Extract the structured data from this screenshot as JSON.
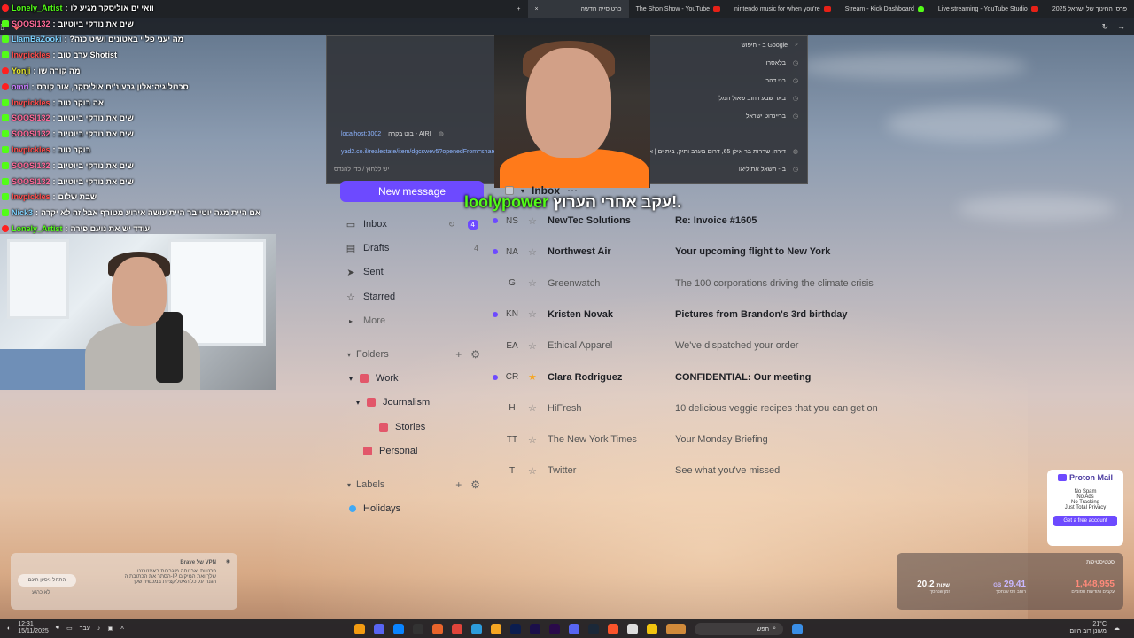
{
  "tabs": [
    {
      "label": "פרסי החינוך של ישראל 2025"
    },
    {
      "label": "Live streaming - YouTube Studio"
    },
    {
      "label": "Stream - Kick Dashboard"
    },
    {
      "label": "nintendo music for when you're"
    },
    {
      "label": "The Shon Show - YouTube"
    },
    {
      "label": "כרטיסייה חדשה"
    }
  ],
  "chat": [
    {
      "user": "Lonely_Artist",
      "text": "וואי ים אוליסקר מגיע לו",
      "ucolor": "#53fc18",
      "src": "yt"
    },
    {
      "user": "SOOSI132",
      "text": "שים את נודקי ביוטיוב",
      "ucolor": "#ff6b9a",
      "src": "kick"
    },
    {
      "user": "LlamBaZooki",
      "text": "?מה יעני פליי באטונים ושיט כזה",
      "ucolor": "#7fd3ff",
      "src": "kick"
    },
    {
      "user": "Invpickles",
      "text": "ערב טוב Shotist",
      "ucolor": "#ff4d4d",
      "src": "kick"
    },
    {
      "user": "Yonji",
      "text": "מה קורה שו",
      "ucolor": "#e6e62a",
      "src": "yt"
    },
    {
      "user": "omri",
      "text": "סכנולוגיה:אלון גרעינ'ים אוליסקר, אור קורס",
      "ucolor": "#c97cff",
      "src": "yt"
    },
    {
      "user": "Invpickles",
      "text": "אה בוקר טוב",
      "ucolor": "#ff4d4d",
      "src": "kick"
    },
    {
      "user": "SOOSI132",
      "text": "שים את נודקי ביוטיוב",
      "ucolor": "#ff6b9a",
      "src": "kick"
    },
    {
      "user": "SOOSI132",
      "text": "שים את נודקי ביוטיוב",
      "ucolor": "#ff6b9a",
      "src": "kick"
    },
    {
      "user": "Invpickles",
      "text": "בוקר טוב",
      "ucolor": "#ff4d4d",
      "src": "kick"
    },
    {
      "user": "SOOSI132",
      "text": "שים את נודקי ביוטיוב",
      "ucolor": "#ff6b9a",
      "src": "kick"
    },
    {
      "user": "SOOSI132",
      "text": "שים את נודקי ביוטיוב",
      "ucolor": "#ff6b9a",
      "src": "kick"
    },
    {
      "user": "Invpickles",
      "text": "שבת שלום",
      "ucolor": "#ff4d4d",
      "src": "kick"
    },
    {
      "user": "Nick3",
      "text": "אם היית מגה יוטיובר היית עושה אירוע מטורף אבל זה לא יקרה",
      "ucolor": "#7fd3ff",
      "src": "kick"
    },
    {
      "user": "Lonely_Artist",
      "text": "עודד יש את נועם פירה",
      "ucolor": "#53fc18",
      "src": "yt"
    }
  ],
  "suggestions": [
    {
      "text": "ב - חיפוש Google"
    },
    {
      "text": "בלאסרו"
    },
    {
      "text": "בני דהר"
    },
    {
      "text": "באר שבע רחוב שאול המלך"
    },
    {
      "text": "בריינרוט ישראל"
    },
    {
      "text": "בוט בקרה - AIRI",
      "url": "localhost:3002"
    },
    {
      "text": "דירה, שדרות בר אילן 65, דרום מערב ותיק, בית ים | אלפי מודעות",
      "url": "yad2.co.il/realestate/item/dgcswev5?openedFrom=share#galleryM"
    },
    {
      "text": "ב - תשאל את ליאו",
      "hint": "יש ללחוץ / כדי להנדס"
    }
  ],
  "overlay": {
    "user": "loolypower",
    "text": "עקב אחרי הערוץ!."
  },
  "mail": {
    "new_message": "New message",
    "nav": {
      "inbox": "Inbox",
      "inbox_count": "4",
      "drafts": "Drafts",
      "drafts_count": "4",
      "sent": "Sent",
      "starred": "Starred",
      "more": "More"
    },
    "folders_label": "Folders",
    "folders": {
      "work": "Work",
      "journalism": "Journalism",
      "stories": "Stories",
      "personal": "Personal"
    },
    "labels_label": "Labels",
    "labels": {
      "holidays": "Holidays"
    },
    "inbox_title": "Inbox",
    "messages": [
      {
        "initials": "NS",
        "sender": "NewTec Solutions",
        "subject": "Re: Invoice #1605",
        "unread": true,
        "starred": false
      },
      {
        "initials": "NA",
        "sender": "Northwest Air",
        "subject": "Your upcoming flight to New York",
        "unread": true,
        "starred": false
      },
      {
        "initials": "G",
        "sender": "Greenwatch",
        "subject": "The 100 corporations driving the climate crisis",
        "unread": false,
        "starred": false
      },
      {
        "initials": "KN",
        "sender": "Kristen Novak",
        "subject": "Pictures from Brandon's 3rd birthday",
        "unread": true,
        "starred": false
      },
      {
        "initials": "EA",
        "sender": "Ethical Apparel",
        "subject": "We've dispatched your order",
        "unread": false,
        "starred": false
      },
      {
        "initials": "CR",
        "sender": "Clara Rodriguez",
        "subject": "CONFIDENTIAL: Our meeting",
        "unread": true,
        "starred": true
      },
      {
        "initials": "H",
        "sender": "HiFresh",
        "subject": "10 delicious veggie recipes that you can get on",
        "unread": false,
        "starred": false
      },
      {
        "initials": "TT",
        "sender": "The New York Times",
        "subject": "Your Monday Briefing",
        "unread": false,
        "starred": false
      },
      {
        "initials": "T",
        "sender": "Twitter",
        "subject": "See what you've missed",
        "unread": false,
        "starred": false
      }
    ]
  },
  "proton_promo": {
    "brand": "Proton Mail",
    "lines": [
      "No Spam",
      "No Ads",
      "No Tracking",
      "Just Total Privacy"
    ],
    "cta": "Get a free account"
  },
  "vpn_promo": {
    "title": "Brave של VPN",
    "lines": [
      "פרטיות ואבטחה מוגברות באינטרנט",
      "הסתר את הכתובת ה-IP שלך ואת המיקום",
      "הגנה על כל האפליקציות במכשיר שלך"
    ],
    "button": "התחל ניסיון חינם",
    "dismiss": "לא כרגע"
  },
  "stats": {
    "title": "סטטיסטיקות",
    "items": [
      {
        "value": "1,448,955",
        "label": "עקבים ומודעות חסומים"
      },
      {
        "value": "29.41",
        "unit": "GB",
        "label": "רוחב פס שנחסך"
      },
      {
        "value": "20.2",
        "unit": "שעות",
        "label": "זמן שנחסך"
      }
    ]
  },
  "taskbar": {
    "time": "12:31",
    "date": "15/11/2025",
    "lang": "עבר",
    "search": "חפש",
    "weather": "21°C",
    "weather_desc": "מעונן רוב היום"
  }
}
